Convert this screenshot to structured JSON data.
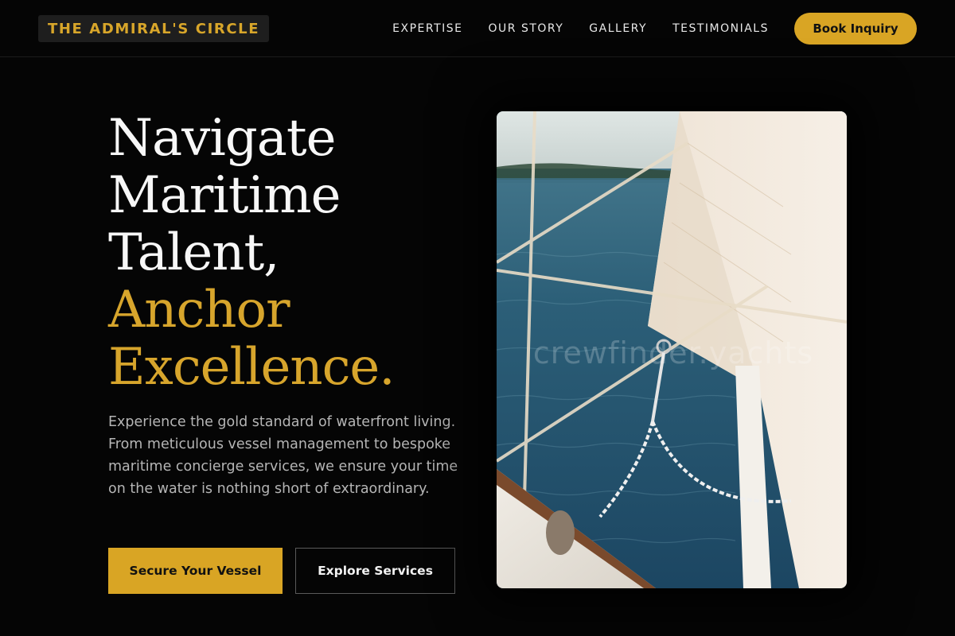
{
  "header": {
    "logo": "THE ADMIRAL'S CIRCLE",
    "nav": [
      "EXPERTISE",
      "OUR STORY",
      "GALLERY",
      "TESTIMONIALS"
    ],
    "cta": "Book Inquiry"
  },
  "hero": {
    "title_lines": [
      "Navigate",
      "Maritime",
      "Talent,"
    ],
    "title_gold_lines": [
      "Anchor",
      "Excellence."
    ],
    "description": "Experience the gold standard of waterfront living. From meticulous vessel management to bespoke maritime concierge services, we ensure your time on the water is nothing short of extraordinary.",
    "primary_button": "Secure Your Vessel",
    "secondary_button": "Explore Services",
    "image_watermark": "crewfinder.yachts"
  },
  "colors": {
    "background": "#050505",
    "accent_gold": "#d9a524",
    "text_light": "#f2f2f2",
    "text_muted": "#b5b5b5"
  },
  "icons": {
    "hero_image": "sailboat-rigging-photo"
  }
}
